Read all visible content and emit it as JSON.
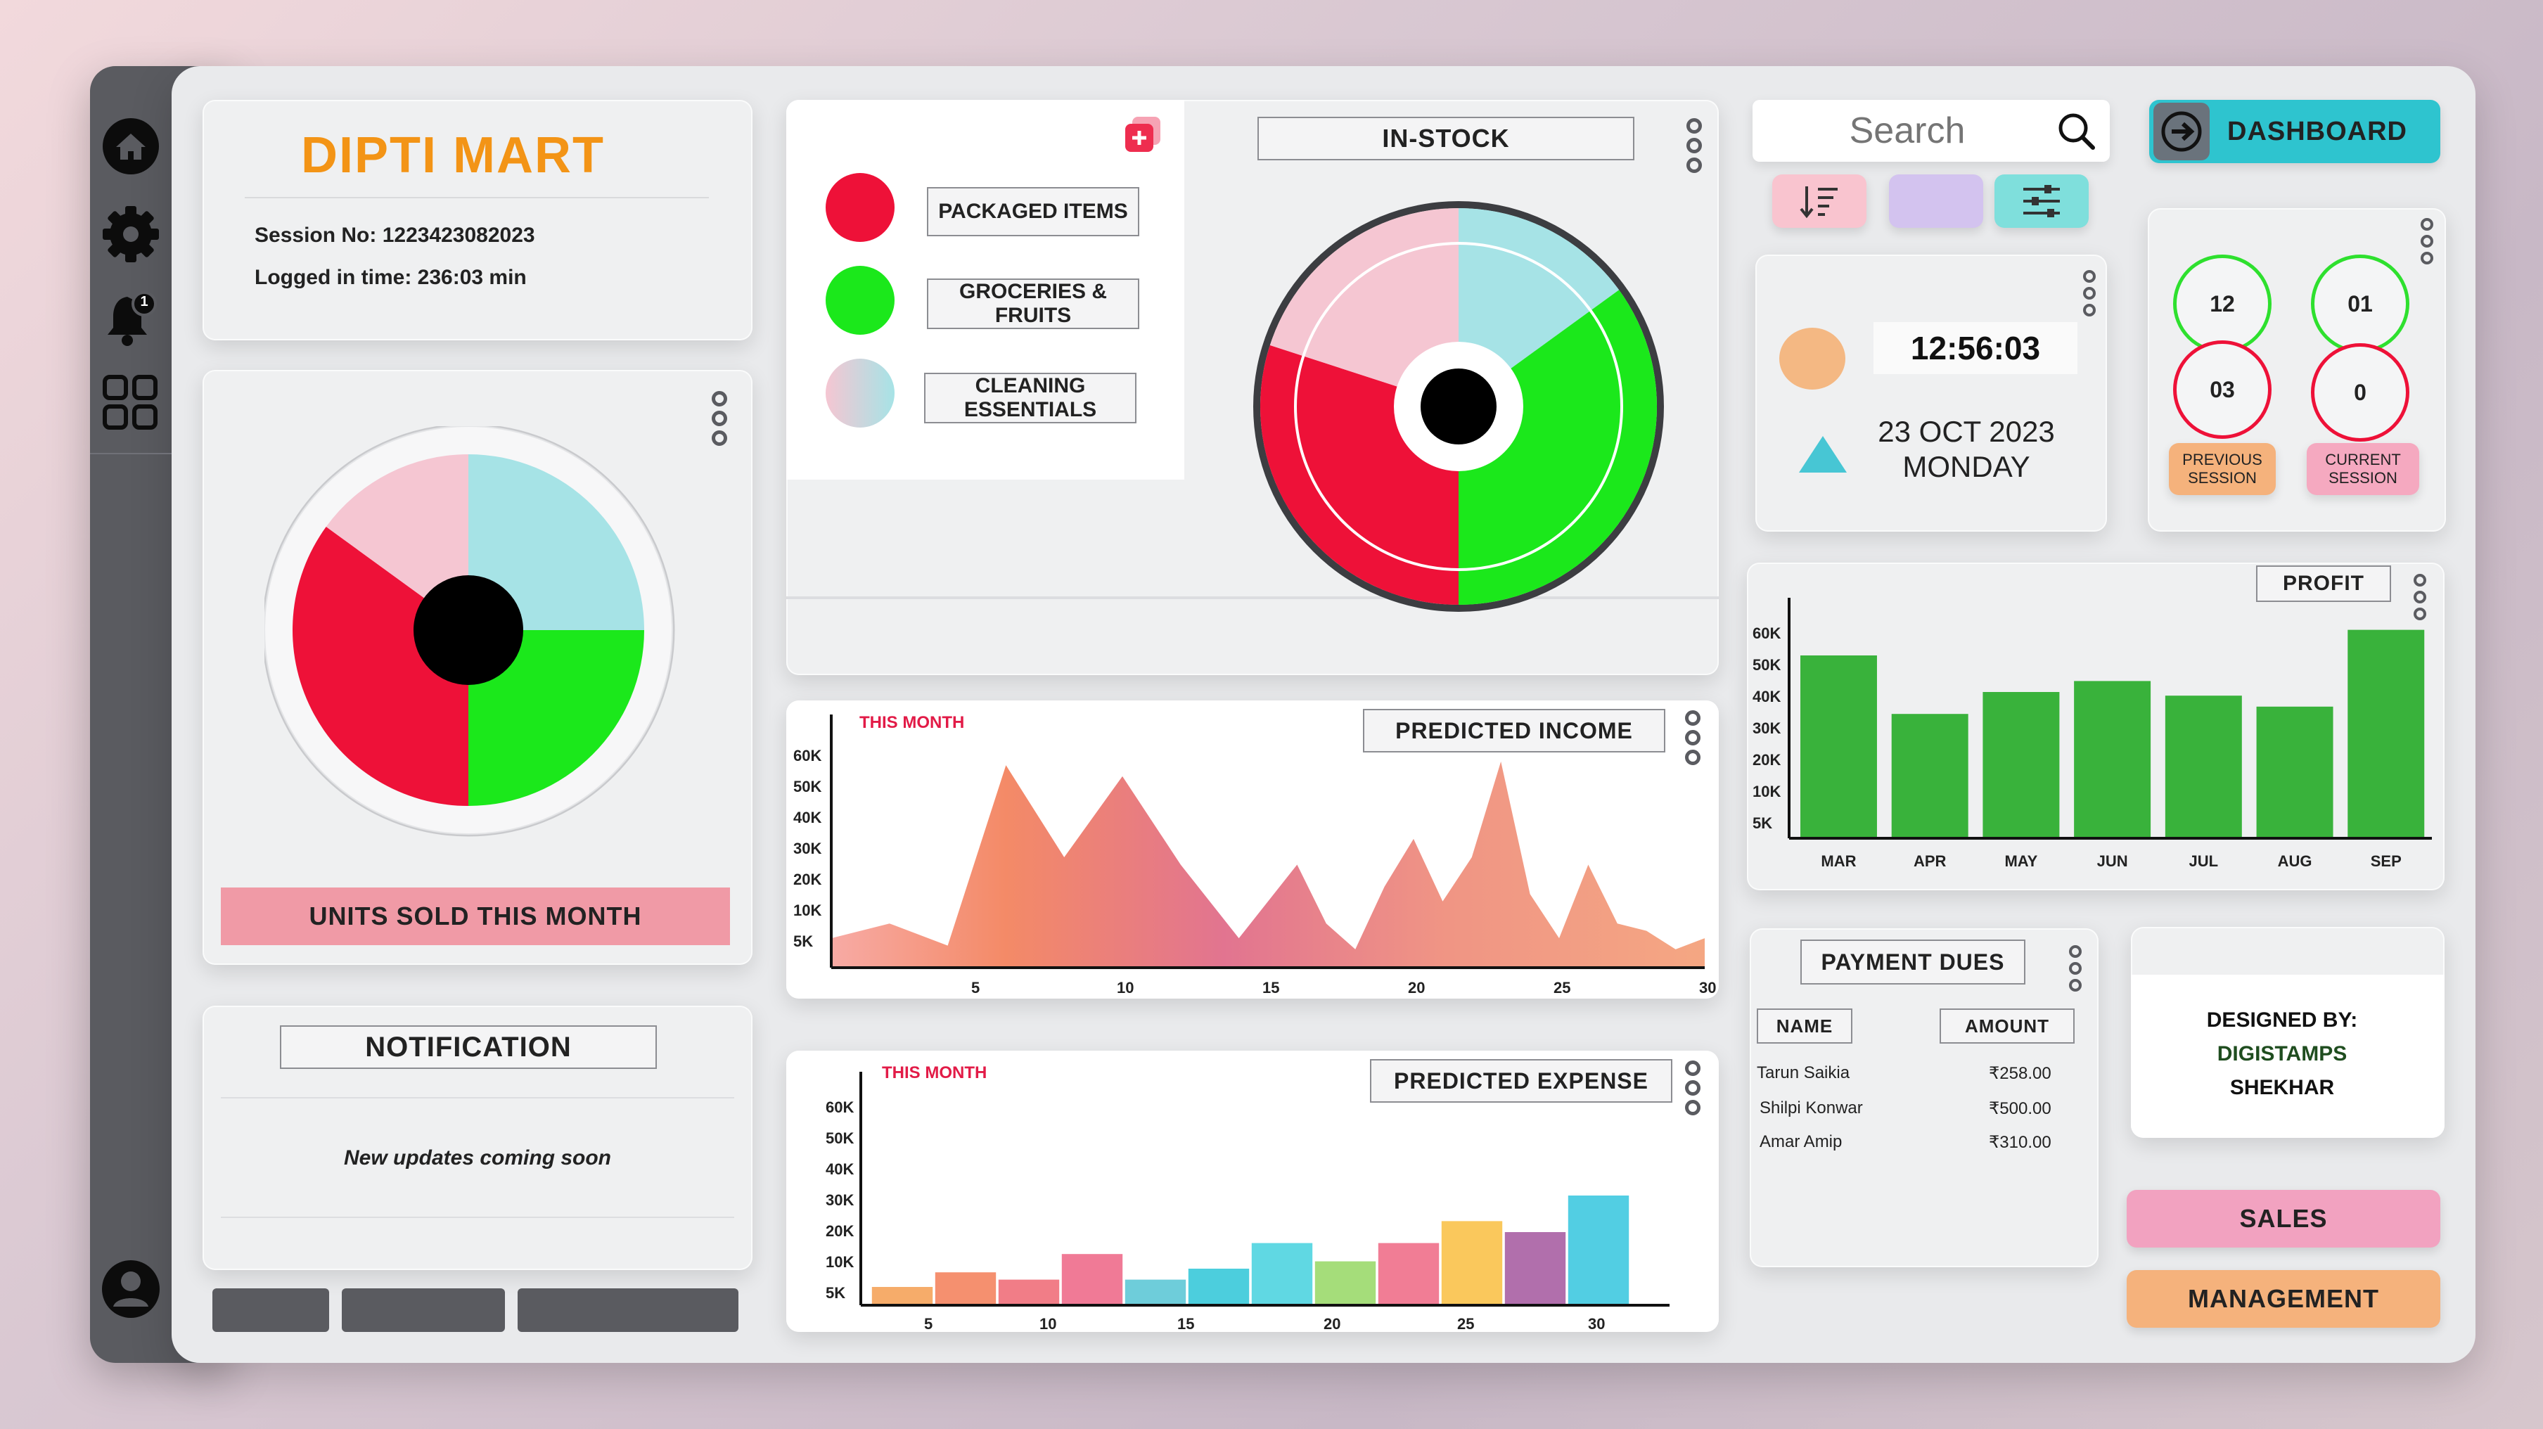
{
  "brand": {
    "name": "DIPTI MART",
    "session_label": "Session No: 1223423082023",
    "logged_label": "Logged in time: 236:03 min"
  },
  "sidebar": {
    "notification_count": "1"
  },
  "units_sold": {
    "title": "UNITS SOLD THIS MONTH"
  },
  "notification": {
    "title": "NOTIFICATION",
    "message": "New updates coming soon"
  },
  "legend": {
    "items": [
      "PACKAGED ITEMS",
      "GROCERIES & FRUITS",
      "CLEANING ESSENTIALS"
    ],
    "colors": [
      "#ee1138",
      "#1be81b",
      "#f5c6d2"
    ]
  },
  "in_stock": {
    "title": "IN-STOCK"
  },
  "predicted_income": {
    "title": "PREDICTED INCOME",
    "subtitle": "THIS MONTH"
  },
  "predicted_expense": {
    "title": "PREDICTED EXPENSE",
    "subtitle": "THIS MONTH"
  },
  "search": {
    "placeholder": "Search"
  },
  "dashboard_button": {
    "label": "DASHBOARD"
  },
  "clock": {
    "time": "12:56:03",
    "date": "23 OCT 2023",
    "day": "MONDAY"
  },
  "sessions": {
    "previous": {
      "top": "12",
      "bottom": "03",
      "label": "PREVIOUS SESSION"
    },
    "current": {
      "top": "01",
      "bottom": "0",
      "label": "CURRENT SESSION"
    }
  },
  "profit": {
    "title": "PROFIT"
  },
  "payment_dues": {
    "title": "PAYMENT DUES",
    "columns": [
      "NAME",
      "AMOUNT"
    ],
    "rows": [
      {
        "name": "Tarun Saikia",
        "amount": "₹258.00"
      },
      {
        "name": "Shilpi Konwar",
        "amount": "₹500.00"
      },
      {
        "name": "Amar Amip",
        "amount": "₹310.00"
      }
    ]
  },
  "designer": {
    "line1": "DESIGNED BY:",
    "line2": "DIGISTAMPS",
    "line3": "SHEKHAR"
  },
  "buttons": {
    "sales": "SALES",
    "management": "MANAGEMENT"
  },
  "colors": {
    "red": "#ee1138",
    "green": "#1be81b",
    "pink": "#f5c6d2",
    "teal": "#a6e3e6",
    "accent_teal": "#2ec4cf",
    "orange": "#f5b27c"
  },
  "chart_data": [
    {
      "type": "pie",
      "name": "units_sold",
      "values": [
        25,
        25,
        35,
        15
      ],
      "colors": [
        "#a6e3e6",
        "#1be81b",
        "#ee1138",
        "#f5c6d2"
      ]
    },
    {
      "type": "pie",
      "name": "in_stock",
      "values": [
        15,
        35,
        30,
        20
      ],
      "colors": [
        "#a6e3e6",
        "#1be81b",
        "#ee1138",
        "#f5c6d2"
      ]
    },
    {
      "type": "area",
      "name": "predicted_income",
      "x_ticks": [
        5,
        10,
        15,
        20,
        25,
        30
      ],
      "y_ticks": [
        "60K",
        "50K",
        "40K",
        "30K",
        "20K",
        "10K",
        "5K"
      ],
      "x": [
        0,
        2,
        4,
        6,
        8,
        10,
        12,
        14,
        16,
        17,
        18,
        19,
        20,
        21,
        22,
        23,
        24,
        25,
        26,
        27,
        28,
        29,
        30
      ],
      "values": [
        8000,
        12000,
        6000,
        55000,
        30000,
        52000,
        28000,
        8000,
        28000,
        12000,
        5000,
        22000,
        35000,
        18000,
        30000,
        56000,
        20000,
        8000,
        28000,
        12000,
        10000,
        5000,
        8000
      ],
      "xlim": [
        0,
        30
      ],
      "ylim": [
        0,
        60000
      ]
    },
    {
      "type": "bar",
      "name": "predicted_expense",
      "x_ticks": [
        5,
        10,
        15,
        20,
        25,
        30
      ],
      "y_ticks": [
        "60K",
        "50K",
        "40K",
        "30K",
        "20K",
        "10K",
        "5K"
      ],
      "values": [
        5000,
        9000,
        7000,
        14000,
        7000,
        10000,
        17000,
        12000,
        17000,
        23000,
        20000,
        30000
      ],
      "colors": [
        "#f5a35a",
        "#f4845f",
        "#f06f7a",
        "#ee6b8b",
        "#5ec8d6",
        "#39c9d9",
        "#4fd4e0",
        "#9bd96c",
        "#ef6f8a",
        "#f9c24a",
        "#a85fa3",
        "#3fc9e0"
      ],
      "ylim": [
        0,
        60000
      ]
    },
    {
      "type": "bar",
      "name": "profit",
      "categories": [
        "MAR",
        "APR",
        "MAY",
        "JUN",
        "JUL",
        "AUG",
        "SEP"
      ],
      "values": [
        50000,
        34000,
        40000,
        43000,
        39000,
        36000,
        57000
      ],
      "y_ticks": [
        "60K",
        "50K",
        "40K",
        "30K",
        "20K",
        "10K",
        "5K"
      ],
      "ylim": [
        0,
        60000
      ],
      "color": "#39b23b"
    }
  ]
}
